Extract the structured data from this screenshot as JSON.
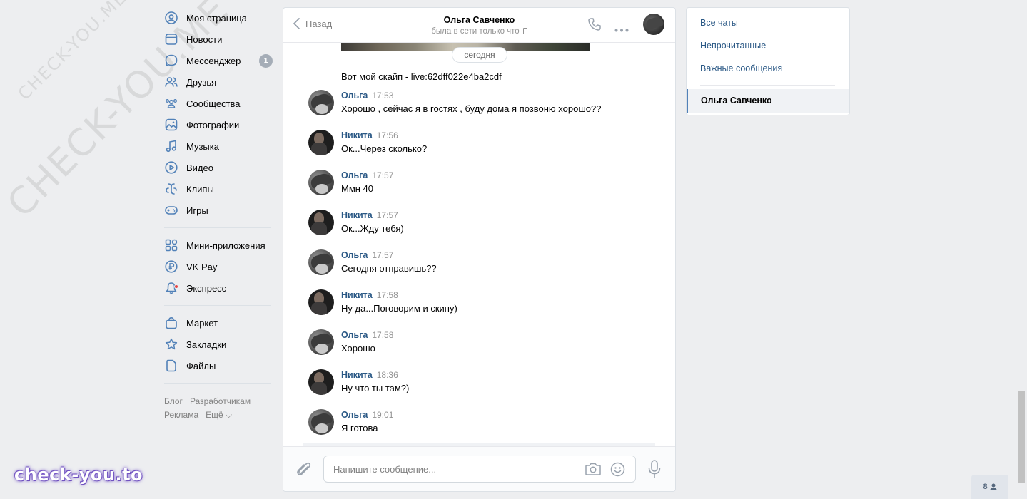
{
  "watermarks": {
    "large": "CHECK-YOU.ME",
    "small": "CHECK-YOU.ME",
    "brand": "check-you.to"
  },
  "nav": {
    "items": [
      {
        "label": "Моя страница",
        "icon": "user-circle-icon"
      },
      {
        "label": "Новости",
        "icon": "news-icon"
      },
      {
        "label": "Мессенджер",
        "icon": "chat-bubble-icon",
        "badge": "1"
      },
      {
        "label": "Друзья",
        "icon": "friends-icon"
      },
      {
        "label": "Сообщества",
        "icon": "communities-icon"
      },
      {
        "label": "Фотографии",
        "icon": "photo-icon"
      },
      {
        "label": "Музыка",
        "icon": "music-icon"
      },
      {
        "label": "Видео",
        "icon": "video-icon"
      },
      {
        "label": "Клипы",
        "icon": "clips-icon"
      },
      {
        "label": "Игры",
        "icon": "gamepad-icon"
      }
    ],
    "apps": [
      {
        "label": "Мини-приложения",
        "icon": "grid-icon"
      },
      {
        "label": "VK Pay",
        "icon": "ruble-icon"
      },
      {
        "label": "Экспресс",
        "icon": "bell-icon"
      }
    ],
    "more": [
      {
        "label": "Маркет",
        "icon": "bag-icon"
      },
      {
        "label": "Закладки",
        "icon": "star-icon"
      },
      {
        "label": "Файлы",
        "icon": "file-icon"
      }
    ],
    "footer": {
      "blog": "Блог",
      "devs": "Разработчикам",
      "ads": "Реклама",
      "more": "Ещё ⌵"
    }
  },
  "chat": {
    "back": "Назад",
    "title": "Ольга Савченко",
    "status": "была в сети только что",
    "date_pill": "сегодня",
    "first_text": "Вот мой скайп - live:62dff022e4ba2cdf",
    "messages": [
      {
        "author": "Ольга",
        "time": "17:53",
        "text": "Хорошо , сейчас я в гостях , буду дома я позвоню хорошо??",
        "who": "olga"
      },
      {
        "author": "Никита",
        "time": "17:56",
        "text": "Ок...Через сколько?",
        "who": "nikita"
      },
      {
        "author": "Ольга",
        "time": "17:57",
        "text": "Ммн 40",
        "who": "olga"
      },
      {
        "author": "Никита",
        "time": "17:57",
        "text": "Ок...Жду тебя)",
        "who": "nikita"
      },
      {
        "author": "Ольга",
        "time": "17:57",
        "text": "Сегодня отправишь??",
        "who": "olga"
      },
      {
        "author": "Никита",
        "time": "17:58",
        "text": "Ну да...Поговорим и скину)",
        "who": "nikita"
      },
      {
        "author": "Ольга",
        "time": "17:58",
        "text": "Хорошо",
        "who": "olga"
      },
      {
        "author": "Никита",
        "time": "18:36",
        "text": "Ну что ты там?)",
        "who": "nikita"
      },
      {
        "author": "Ольга",
        "time": "19:01",
        "text": "Я готова",
        "who": "olga"
      }
    ],
    "composer": {
      "placeholder": "Напишите сообщение..."
    }
  },
  "filters": {
    "all": "Все чаты",
    "unread": "Непрочитанные",
    "important": "Важные сообщения",
    "active": "Ольга Савченко"
  },
  "online_count": "8",
  "colors": {
    "link": "#2a5885",
    "bg": "#edeef0",
    "accent": "#5181b8"
  }
}
